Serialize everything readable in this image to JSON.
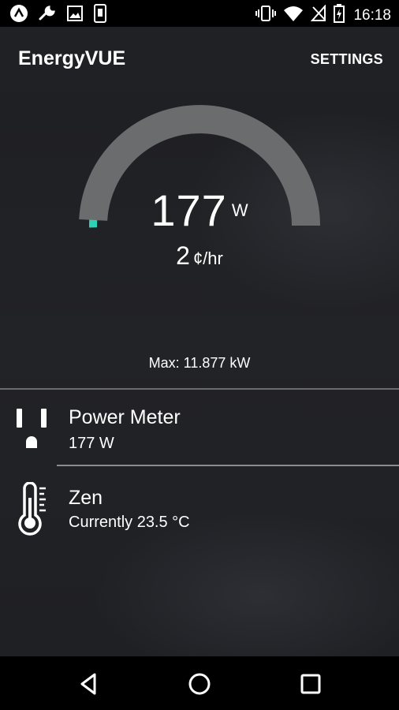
{
  "status_bar": {
    "time": "16:18",
    "left_icons": [
      "app-icon",
      "wrench-icon",
      "image-icon",
      "phone-icon"
    ],
    "right_icons": [
      "vibrate-icon",
      "wifi-icon",
      "no-signal-icon",
      "battery-charging-icon"
    ]
  },
  "app_bar": {
    "title": "EnergyVUE",
    "settings_label": "SETTINGS"
  },
  "gauge": {
    "power_value": "177",
    "power_unit": "W",
    "cost_value": "2",
    "cost_unit": "¢/hr",
    "max_label": "Max: 11.877 kW",
    "fill_fraction": 0.015,
    "track_color": "#6b6c6e",
    "fill_color": "#2bd4b4"
  },
  "devices": [
    {
      "title": "Power Meter",
      "subtitle": "177 W",
      "icon": "outlet-icon"
    },
    {
      "title": "Zen",
      "subtitle": "Currently 23.5 °C",
      "icon": "thermometer-icon"
    }
  ],
  "nav_bar": {
    "buttons": [
      "back-icon",
      "home-icon",
      "recents-icon"
    ]
  }
}
